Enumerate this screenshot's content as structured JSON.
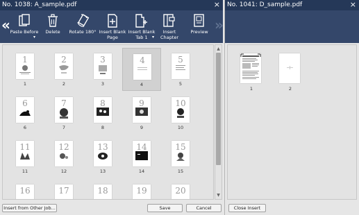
{
  "left_panel": {
    "title": "No. 1038: A_sample.pdf",
    "close_icon": "×",
    "toolbar": {
      "nav_left": "«",
      "buttons": [
        {
          "id": "paste",
          "label": "Paste Before",
          "icon": "paste-icon",
          "has_dropdown": true
        },
        {
          "id": "delete",
          "label": "Delete",
          "icon": "trash-icon"
        },
        {
          "id": "rotate",
          "label": "Rotate 180°",
          "icon": "rotate-icon"
        },
        {
          "id": "insert_blank_page",
          "label": "Insert Blank\nPage",
          "icon": "insert-blank-page-icon"
        },
        {
          "id": "insert_blank_tab",
          "label": "Insert Blank\nTab 1",
          "icon": "insert-blank-tab-icon",
          "has_dropdown": true
        },
        {
          "id": "insert_chapter",
          "label": "Insert\nChapter",
          "icon": "insert-chapter-icon"
        },
        {
          "id": "preview",
          "label": "Preview",
          "icon": "preview-icon"
        }
      ],
      "nav_right": "»"
    },
    "pages": [
      {
        "num": "1",
        "caption": "1"
      },
      {
        "num": "2",
        "caption": "2"
      },
      {
        "num": "3",
        "caption": "3"
      },
      {
        "num": "4",
        "caption": "4",
        "selected": true
      },
      {
        "num": "5",
        "caption": "5"
      },
      {
        "num": "6",
        "caption": "6"
      },
      {
        "num": "7",
        "caption": "7"
      },
      {
        "num": "8",
        "caption": "8"
      },
      {
        "num": "9",
        "caption": "9"
      },
      {
        "num": "10",
        "caption": "10"
      },
      {
        "num": "11",
        "caption": "11"
      },
      {
        "num": "12",
        "caption": "12"
      },
      {
        "num": "13",
        "caption": "13"
      },
      {
        "num": "14",
        "caption": "14"
      },
      {
        "num": "15",
        "caption": "15"
      },
      {
        "num": "16",
        "caption": ""
      },
      {
        "num": "17",
        "caption": ""
      },
      {
        "num": "18",
        "caption": ""
      },
      {
        "num": "19",
        "caption": ""
      },
      {
        "num": "20",
        "caption": ""
      }
    ],
    "footer": {
      "insert_from_other": "Insert from Other Job...",
      "save": "Save",
      "cancel": "Cancel"
    }
  },
  "right_panel": {
    "title": "No. 1041: D_sample.pdf",
    "close_icon": "×",
    "pages": [
      {
        "caption": "1"
      },
      {
        "caption": "2"
      }
    ],
    "footer": {
      "close_insert": "Close Insert"
    }
  },
  "colors": {
    "title_bar": "#253858",
    "toolbar": "#34476a",
    "background": "#e6e6e6"
  }
}
